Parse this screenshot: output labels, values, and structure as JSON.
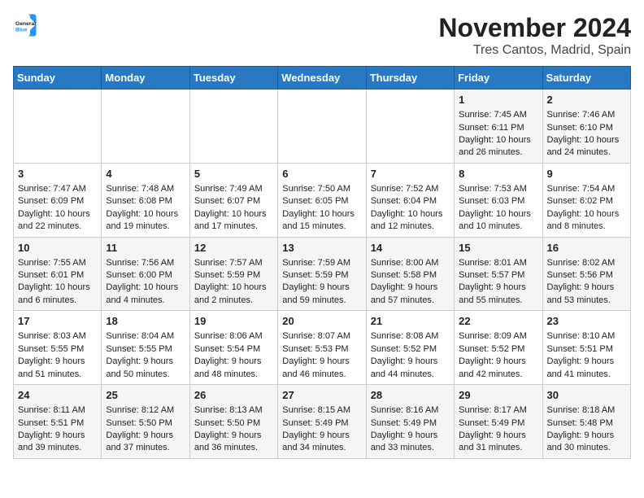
{
  "header": {
    "logo_line1": "General",
    "logo_line2": "Blue",
    "month": "November 2024",
    "location": "Tres Cantos, Madrid, Spain"
  },
  "days_of_week": [
    "Sunday",
    "Monday",
    "Tuesday",
    "Wednesday",
    "Thursday",
    "Friday",
    "Saturday"
  ],
  "weeks": [
    [
      {
        "day": "",
        "info": ""
      },
      {
        "day": "",
        "info": ""
      },
      {
        "day": "",
        "info": ""
      },
      {
        "day": "",
        "info": ""
      },
      {
        "day": "",
        "info": ""
      },
      {
        "day": "1",
        "info": "Sunrise: 7:45 AM\nSunset: 6:11 PM\nDaylight: 10 hours and 26 minutes."
      },
      {
        "day": "2",
        "info": "Sunrise: 7:46 AM\nSunset: 6:10 PM\nDaylight: 10 hours and 24 minutes."
      }
    ],
    [
      {
        "day": "3",
        "info": "Sunrise: 7:47 AM\nSunset: 6:09 PM\nDaylight: 10 hours and 22 minutes."
      },
      {
        "day": "4",
        "info": "Sunrise: 7:48 AM\nSunset: 6:08 PM\nDaylight: 10 hours and 19 minutes."
      },
      {
        "day": "5",
        "info": "Sunrise: 7:49 AM\nSunset: 6:07 PM\nDaylight: 10 hours and 17 minutes."
      },
      {
        "day": "6",
        "info": "Sunrise: 7:50 AM\nSunset: 6:05 PM\nDaylight: 10 hours and 15 minutes."
      },
      {
        "day": "7",
        "info": "Sunrise: 7:52 AM\nSunset: 6:04 PM\nDaylight: 10 hours and 12 minutes."
      },
      {
        "day": "8",
        "info": "Sunrise: 7:53 AM\nSunset: 6:03 PM\nDaylight: 10 hours and 10 minutes."
      },
      {
        "day": "9",
        "info": "Sunrise: 7:54 AM\nSunset: 6:02 PM\nDaylight: 10 hours and 8 minutes."
      }
    ],
    [
      {
        "day": "10",
        "info": "Sunrise: 7:55 AM\nSunset: 6:01 PM\nDaylight: 10 hours and 6 minutes."
      },
      {
        "day": "11",
        "info": "Sunrise: 7:56 AM\nSunset: 6:00 PM\nDaylight: 10 hours and 4 minutes."
      },
      {
        "day": "12",
        "info": "Sunrise: 7:57 AM\nSunset: 5:59 PM\nDaylight: 10 hours and 2 minutes."
      },
      {
        "day": "13",
        "info": "Sunrise: 7:59 AM\nSunset: 5:59 PM\nDaylight: 9 hours and 59 minutes."
      },
      {
        "day": "14",
        "info": "Sunrise: 8:00 AM\nSunset: 5:58 PM\nDaylight: 9 hours and 57 minutes."
      },
      {
        "day": "15",
        "info": "Sunrise: 8:01 AM\nSunset: 5:57 PM\nDaylight: 9 hours and 55 minutes."
      },
      {
        "day": "16",
        "info": "Sunrise: 8:02 AM\nSunset: 5:56 PM\nDaylight: 9 hours and 53 minutes."
      }
    ],
    [
      {
        "day": "17",
        "info": "Sunrise: 8:03 AM\nSunset: 5:55 PM\nDaylight: 9 hours and 51 minutes."
      },
      {
        "day": "18",
        "info": "Sunrise: 8:04 AM\nSunset: 5:55 PM\nDaylight: 9 hours and 50 minutes."
      },
      {
        "day": "19",
        "info": "Sunrise: 8:06 AM\nSunset: 5:54 PM\nDaylight: 9 hours and 48 minutes."
      },
      {
        "day": "20",
        "info": "Sunrise: 8:07 AM\nSunset: 5:53 PM\nDaylight: 9 hours and 46 minutes."
      },
      {
        "day": "21",
        "info": "Sunrise: 8:08 AM\nSunset: 5:52 PM\nDaylight: 9 hours and 44 minutes."
      },
      {
        "day": "22",
        "info": "Sunrise: 8:09 AM\nSunset: 5:52 PM\nDaylight: 9 hours and 42 minutes."
      },
      {
        "day": "23",
        "info": "Sunrise: 8:10 AM\nSunset: 5:51 PM\nDaylight: 9 hours and 41 minutes."
      }
    ],
    [
      {
        "day": "24",
        "info": "Sunrise: 8:11 AM\nSunset: 5:51 PM\nDaylight: 9 hours and 39 minutes."
      },
      {
        "day": "25",
        "info": "Sunrise: 8:12 AM\nSunset: 5:50 PM\nDaylight: 9 hours and 37 minutes."
      },
      {
        "day": "26",
        "info": "Sunrise: 8:13 AM\nSunset: 5:50 PM\nDaylight: 9 hours and 36 minutes."
      },
      {
        "day": "27",
        "info": "Sunrise: 8:15 AM\nSunset: 5:49 PM\nDaylight: 9 hours and 34 minutes."
      },
      {
        "day": "28",
        "info": "Sunrise: 8:16 AM\nSunset: 5:49 PM\nDaylight: 9 hours and 33 minutes."
      },
      {
        "day": "29",
        "info": "Sunrise: 8:17 AM\nSunset: 5:49 PM\nDaylight: 9 hours and 31 minutes."
      },
      {
        "day": "30",
        "info": "Sunrise: 8:18 AM\nSunset: 5:48 PM\nDaylight: 9 hours and 30 minutes."
      }
    ]
  ]
}
